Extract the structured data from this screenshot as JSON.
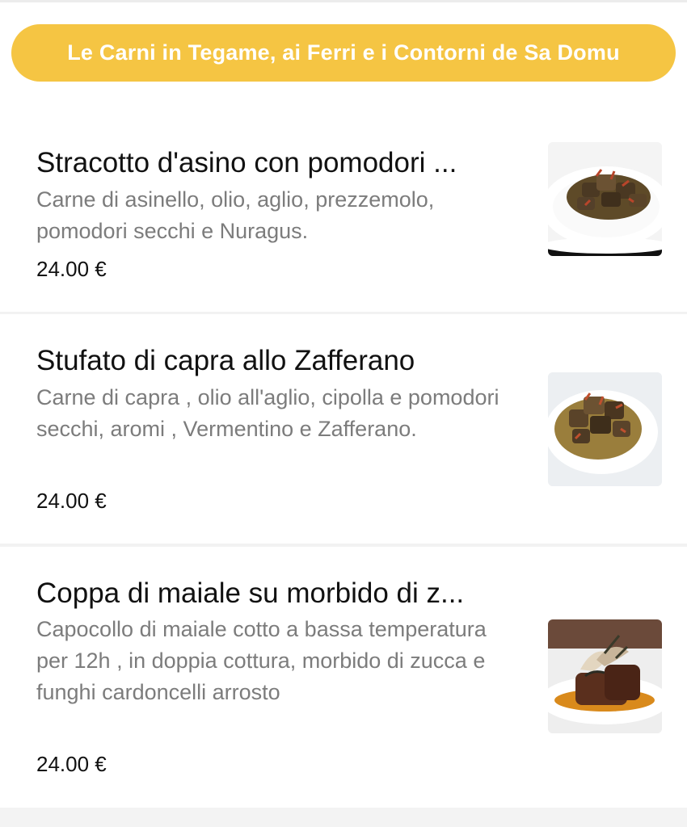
{
  "category": {
    "label": "Le Carni in Tegame, ai Ferri e i Contorni de Sa Domu"
  },
  "items": [
    {
      "title": "Stracotto d'asino con pomodori ...",
      "description": "Carne di asinello, olio, aglio, prezzemolo, pomodori secchi e Nuragus.",
      "price": "24.00 €",
      "image": "stewed-meat-dish-icon"
    },
    {
      "title": "Stufato di capra allo Zafferano",
      "description": "Carne di capra , olio all'aglio, cipolla e pomodori secchi, aromi , Vermentino e Zafferano.",
      "price": "24.00 €",
      "image": "goat-stew-dish-icon"
    },
    {
      "title": "Coppa di maiale su morbido di z...",
      "description": "Capocollo di maiale cotto a bassa temperatura per 12h , in doppia cottura, morbido di zucca e funghi cardoncelli arrosto",
      "price": "24.00 €",
      "image": "pork-with-mushrooms-dish-icon"
    }
  ],
  "colors": {
    "category_bg": "#f5c543",
    "category_text": "#ffffff",
    "title_text": "#111111",
    "description_text": "#7c7c7c",
    "divider": "#f2f2f2"
  }
}
